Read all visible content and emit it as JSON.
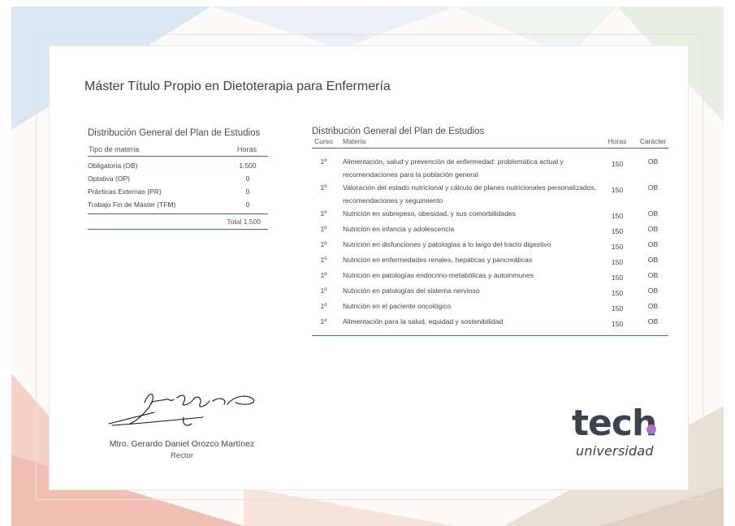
{
  "title": "Máster Título Propio en Dietoterapia para Enfermería",
  "summary_table": {
    "heading": "Distribución General del Plan de Estudios",
    "col_type": "Tipo de materia",
    "col_hours": "Horas",
    "rows": [
      {
        "type": "Obligatoria (OB)",
        "hours": "1.500"
      },
      {
        "type": "Optativa (OP)",
        "hours": "0"
      },
      {
        "type": "Prácticas Externas (PR)",
        "hours": "0"
      },
      {
        "type": "Trabajo Fin de Máster (TFM)",
        "hours": "0"
      }
    ],
    "total": "Total 1.500"
  },
  "plan_table": {
    "heading": "Distribución General del Plan de Estudios",
    "col_course": "Curso",
    "col_subject": "Materia",
    "col_hours": "Horas",
    "col_type": "Carácter",
    "rows": [
      {
        "course": "1º",
        "subject": "Alimentación, salud y prevención de enfermedad: problemática actual y recomendaciones para la población general",
        "hours": "150",
        "type": "OB"
      },
      {
        "course": "1º",
        "subject": "Valoración del estado nutricional y cálculo de planes nutricionales personalizados, recomendaciones y seguimiento",
        "hours": "150",
        "type": "OB"
      },
      {
        "course": "1º",
        "subject": "Nutrición en sobrepeso, obesidad, y sus comorbilidades",
        "hours": "150",
        "type": "OB"
      },
      {
        "course": "1º",
        "subject": "Nutrición en infancia y adolescencia",
        "hours": "150",
        "type": "OB"
      },
      {
        "course": "1º",
        "subject": "Nutrición en disfunciones y patologías a lo largo del tracto digestivo",
        "hours": "150",
        "type": "OB"
      },
      {
        "course": "1º",
        "subject": "Nutrición en enfermedades renales, hepáticas y pancreáticas",
        "hours": "150",
        "type": "OB"
      },
      {
        "course": "1º",
        "subject": "Nutrición en patologías endocrino-metabólicas y autoinmunes",
        "hours": "150",
        "type": "OB"
      },
      {
        "course": "1º",
        "subject": "Nutrición en patologías del sistema nervioso",
        "hours": "150",
        "type": "OB"
      },
      {
        "course": "1º",
        "subject": "Nutrición en el paciente oncológico",
        "hours": "150",
        "type": "OB"
      },
      {
        "course": "1º",
        "subject": "Alimentación para la salud, equidad y sostenibilidad",
        "hours": "150",
        "type": "OB"
      }
    ]
  },
  "signatory": {
    "name": "Mtro. Gerardo Daniel Orozco Martínez",
    "role": "Rector"
  },
  "logo": {
    "word": "tech",
    "subtitle": "universidad"
  },
  "colors": {
    "accent_line": "#2d6db5",
    "text": "#444444"
  }
}
